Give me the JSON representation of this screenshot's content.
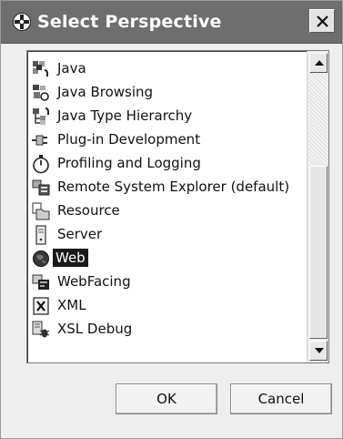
{
  "window": {
    "title": "Select Perspective",
    "title_icon": "open-perspective-icon",
    "close_icon": "close-icon"
  },
  "perspectives": {
    "items": [
      {
        "label": "Java",
        "icon": "java-perspective-icon",
        "selected": false
      },
      {
        "label": "Java Browsing",
        "icon": "java-browsing-icon",
        "selected": false
      },
      {
        "label": "Java Type Hierarchy",
        "icon": "type-hierarchy-icon",
        "selected": false
      },
      {
        "label": "Plug-in Development",
        "icon": "plugin-icon",
        "selected": false
      },
      {
        "label": "Profiling and Logging",
        "icon": "stopwatch-icon",
        "selected": false
      },
      {
        "label": "Remote System Explorer (default)",
        "icon": "remote-system-icon",
        "selected": false
      },
      {
        "label": "Resource",
        "icon": "resource-folder-icon",
        "selected": false
      },
      {
        "label": "Server",
        "icon": "server-icon",
        "selected": false
      },
      {
        "label": "Web",
        "icon": "globe-icon",
        "selected": true
      },
      {
        "label": "WebFacing",
        "icon": "webfacing-icon",
        "selected": false
      },
      {
        "label": "XML",
        "icon": "xml-icon",
        "selected": false
      },
      {
        "label": "XSL Debug",
        "icon": "xsl-debug-icon",
        "selected": false
      }
    ],
    "scroll_position": 0.72
  },
  "buttons": {
    "ok_label": "OK",
    "cancel_label": "Cancel"
  }
}
